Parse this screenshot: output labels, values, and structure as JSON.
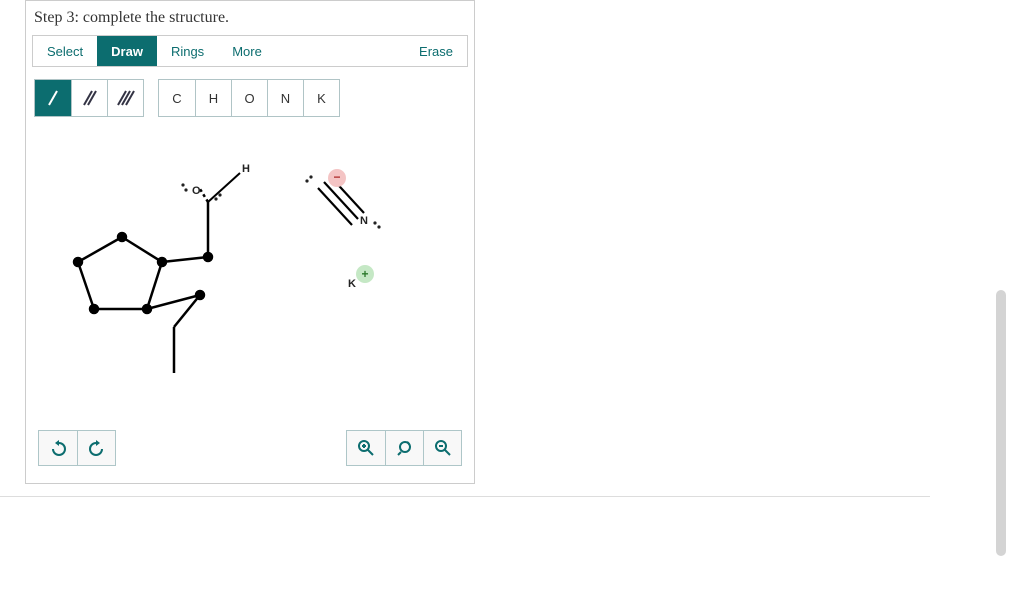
{
  "title": "Step 3: complete the structure.",
  "tabs": {
    "select": "Select",
    "draw": "Draw",
    "rings": "Rings",
    "more": "More",
    "erase": "Erase",
    "active": "draw"
  },
  "bond_tools": {
    "single": "/",
    "double": "//",
    "triple": "///",
    "active": "single"
  },
  "atom_shelf": [
    "C",
    "H",
    "O",
    "N",
    "K"
  ],
  "molecule": {
    "oxygen_label": "O",
    "hydrogen_label": "H",
    "nitrogen_label": "N",
    "potassium_label": "K",
    "neg_sign": "−",
    "pos_sign": "+"
  },
  "bottom_tools": {
    "undo": "undo",
    "redo": "redo",
    "zoom_in": "zoom-in",
    "zoom_fit": "zoom-fit",
    "zoom_out": "zoom-out"
  }
}
